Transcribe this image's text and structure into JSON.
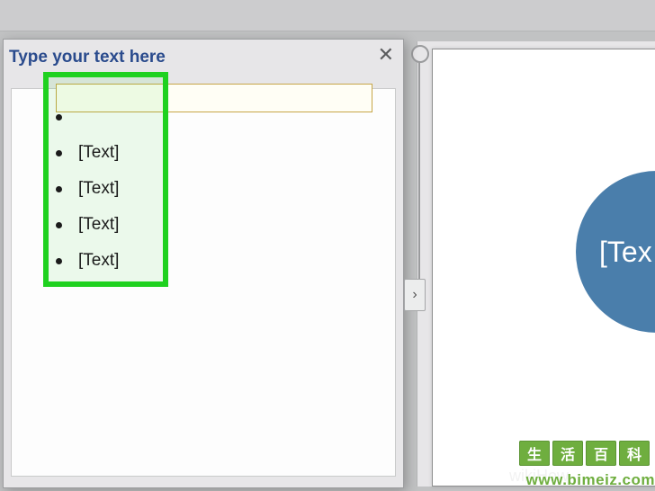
{
  "panel": {
    "title": "Type your text here",
    "close_glyph": "✕",
    "items": [
      {
        "label": ""
      },
      {
        "label": "[Text]"
      },
      {
        "label": "[Text]"
      },
      {
        "label": "[Text]"
      },
      {
        "label": "[Text]"
      }
    ]
  },
  "expand_handle_glyph": "›",
  "shape": {
    "circle_text": "[Tex"
  },
  "watermark": {
    "logo_chars": [
      "生",
      "活",
      "百",
      "科"
    ],
    "url": "www.bimeiz.com",
    "wikihow": "wikiHow"
  }
}
